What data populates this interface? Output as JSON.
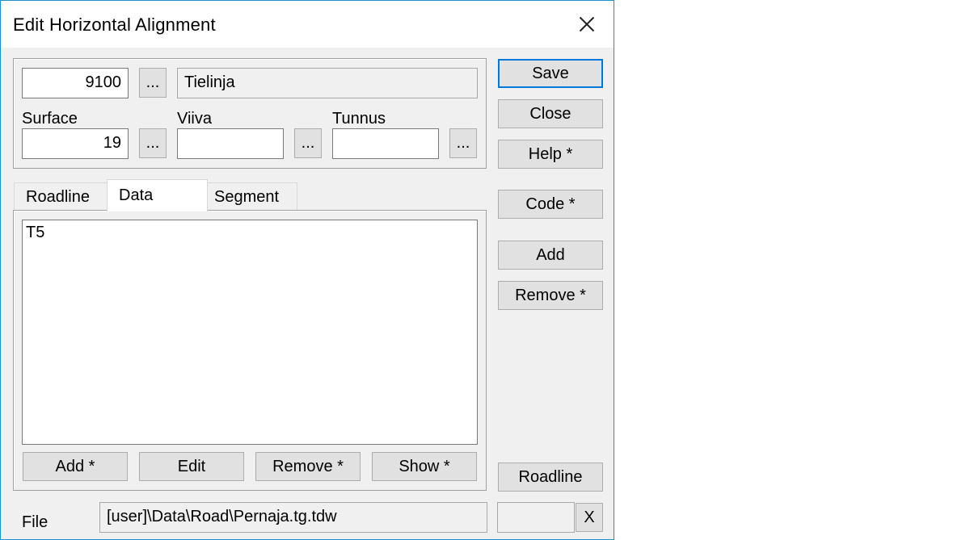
{
  "window": {
    "title": "Edit Horizontal Alignment",
    "close_glyph": "close-icon"
  },
  "top": {
    "number_value": "9100",
    "number_browse": "...",
    "name_value": "Tielinja",
    "surface_label": "Surface",
    "surface_value": "19",
    "surface_browse": "...",
    "viiva_label": "Viiva",
    "viiva_value": "",
    "viiva_browse": "...",
    "tunnus_label": "Tunnus",
    "tunnus_value": "",
    "tunnus_browse": "..."
  },
  "tabs": [
    {
      "label": "Roadline"
    },
    {
      "label": "Data",
      "active": true
    },
    {
      "label": "Segment"
    }
  ],
  "list": {
    "items": [
      "T5"
    ]
  },
  "list_buttons": {
    "add": "Add *",
    "edit": "Edit",
    "remove": "Remove *",
    "show": "Show *"
  },
  "side_buttons": {
    "save": "Save",
    "close": "Close",
    "help": "Help *",
    "code": "Code *",
    "add": "Add",
    "remove": "Remove *",
    "roadline": "Roadline"
  },
  "footer": {
    "file_label": "File",
    "file_path": "[user]\\Data\\Road\\Pernaja.tg.tdw",
    "extra_value": "",
    "x_button": "X"
  }
}
